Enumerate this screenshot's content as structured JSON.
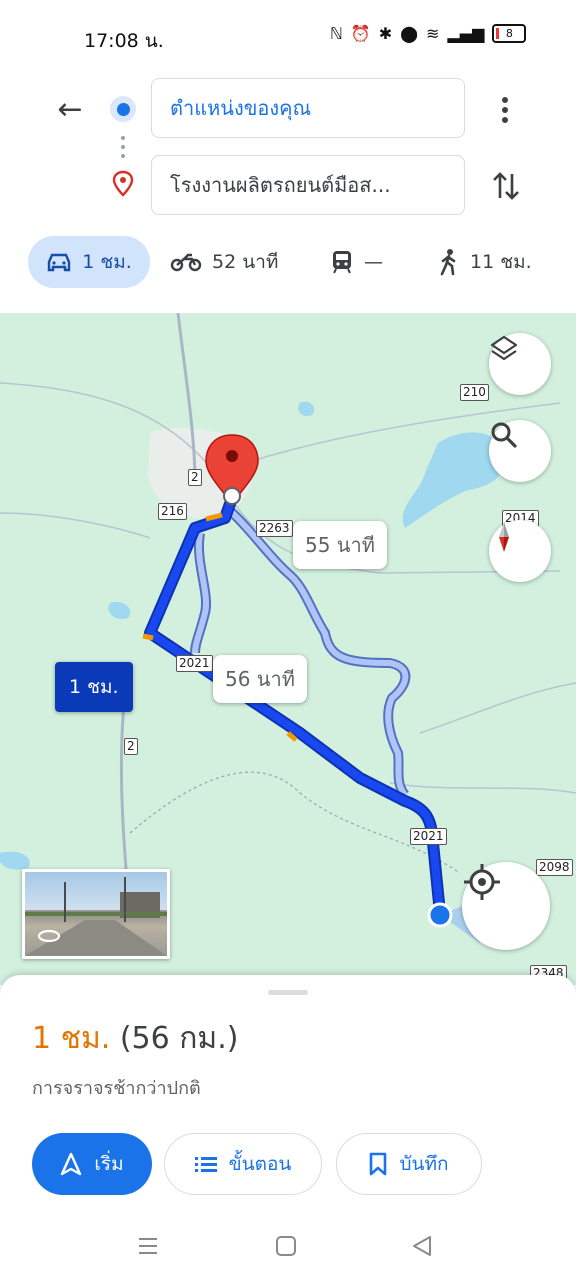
{
  "status_bar": {
    "time": "17:08 น.",
    "battery": "8"
  },
  "search": {
    "origin": "ตำแหน่งของคุณ",
    "destination": "โรงงานผลิตรถยนต์มือส..."
  },
  "modes": {
    "car": "1 ชม.",
    "motorcycle": "52 นาที",
    "transit": "—",
    "walk": "11 ชม."
  },
  "map": {
    "route_labels": {
      "primary": "1 ชม.",
      "alt1": "55 นาที",
      "alt2": "56 นาที"
    },
    "shields": [
      "210",
      "2",
      "216",
      "2263",
      "2014",
      "2021",
      "2",
      "2021",
      "2098",
      "2348"
    ]
  },
  "sheet": {
    "duration": "1 ชม.",
    "distance": "(56 กม.)",
    "traffic_note": "การจราจรช้ากว่าปกติ",
    "start_label": "เริ่ม",
    "steps_label": "ขั้นตอน",
    "save_label": "บันทึก"
  },
  "colors": {
    "accent": "#1a73e8",
    "route": "#1a3fe0",
    "duration": "#e37400"
  }
}
